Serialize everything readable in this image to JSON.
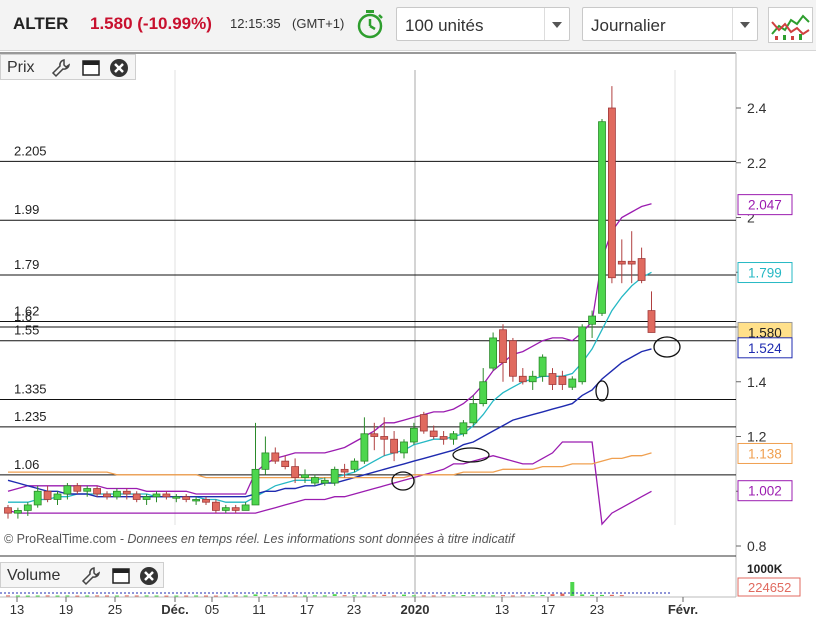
{
  "header": {
    "ticker": "ALTER",
    "price_change": "1.580 (-10.99%)",
    "time": "12:15:35",
    "timezone": "(GMT+1)",
    "quantity": "100 unités",
    "period": "Journalier"
  },
  "panes": {
    "price_label": "Prix",
    "volume_label": "Volume"
  },
  "copyright": "© ProRealTime.com",
  "disclaimer": " - Donnees en temps réel. Les informations sont données à titre indicatif",
  "colors": {
    "up": "#4dd64d",
    "down": "#e06a5f",
    "bollinger": "#9b1cb0",
    "ma_short": "#25b8c4",
    "ma_long": "#1f2bb0",
    "ma_slow": "#f0a050",
    "price_label": "#c8102e"
  },
  "chart_data": {
    "type": "candlestick",
    "y_axis_ticks": [
      "2.4",
      "2.2",
      "2",
      "1.8",
      "1.6",
      "1.4",
      "1.2",
      "1",
      "0.8"
    ],
    "x_axis_ticks": [
      "13",
      "19",
      "25",
      "Déc.",
      "05",
      "11",
      "17",
      "23",
      "2020",
      "13",
      "17",
      "23",
      "Févr."
    ],
    "ylim": [
      0.8,
      2.5
    ],
    "support_levels": [
      {
        "label": "2.205",
        "value": 2.205
      },
      {
        "label": "1.99",
        "value": 1.99
      },
      {
        "label": "1.79",
        "value": 1.79
      },
      {
        "label": "1.62",
        "value": 1.62
      },
      {
        "label": "1.6",
        "value": 1.6
      },
      {
        "label": "1.55",
        "value": 1.55
      },
      {
        "label": "1.335",
        "value": 1.335
      },
      {
        "label": "1.235",
        "value": 1.235
      },
      {
        "label": "1.06",
        "value": 1.06
      }
    ],
    "last_values": [
      {
        "label": "2.047",
        "value": 2.047,
        "color": "#9b1cb0"
      },
      {
        "label": "1.799",
        "value": 1.799,
        "color": "#25b8c4"
      },
      {
        "label": "1.580",
        "value": 1.58,
        "color": "#222222"
      },
      {
        "label": "1.524",
        "value": 1.524,
        "color": "#1f2bb0"
      },
      {
        "label": "1.138",
        "value": 1.138,
        "color": "#f0a050"
      },
      {
        "label": "1.002",
        "value": 1.002,
        "color": "#9b1cb0"
      }
    ],
    "volume": {
      "axis_label": "1000K",
      "last_value": "224652",
      "values": [
        15,
        12,
        10,
        12,
        14,
        11,
        13,
        10,
        12,
        14,
        13,
        12,
        15,
        13,
        14,
        12,
        10,
        11,
        12,
        13,
        12,
        11,
        12,
        14,
        13,
        40,
        20,
        18,
        15,
        14,
        13,
        16,
        15,
        45,
        20,
        18,
        14,
        16,
        30,
        15,
        35,
        17,
        15,
        14,
        20,
        18,
        25,
        20,
        18,
        16,
        22,
        14,
        18,
        20,
        24,
        45,
        60,
        350,
        40,
        30,
        28,
        30,
        22
      ]
    },
    "candles": [
      {
        "o": 0.94,
        "h": 0.95,
        "l": 0.9,
        "c": 0.92
      },
      {
        "o": 0.92,
        "h": 0.94,
        "l": 0.9,
        "c": 0.93
      },
      {
        "o": 0.93,
        "h": 0.96,
        "l": 0.91,
        "c": 0.95
      },
      {
        "o": 0.95,
        "h": 1.02,
        "l": 0.94,
        "c": 1.0
      },
      {
        "o": 1.0,
        "h": 1.02,
        "l": 0.96,
        "c": 0.97
      },
      {
        "o": 0.97,
        "h": 1.0,
        "l": 0.95,
        "c": 0.99
      },
      {
        "o": 0.99,
        "h": 1.03,
        "l": 0.97,
        "c": 1.02
      },
      {
        "o": 1.02,
        "h": 1.03,
        "l": 0.99,
        "c": 1.0
      },
      {
        "o": 1.0,
        "h": 1.02,
        "l": 0.98,
        "c": 1.01
      },
      {
        "o": 1.01,
        "h": 1.02,
        "l": 0.98,
        "c": 0.99
      },
      {
        "o": 0.99,
        "h": 1.0,
        "l": 0.97,
        "c": 0.98
      },
      {
        "o": 0.98,
        "h": 1.01,
        "l": 0.97,
        "c": 1.0
      },
      {
        "o": 1.0,
        "h": 1.01,
        "l": 0.97,
        "c": 0.99
      },
      {
        "o": 0.99,
        "h": 1.0,
        "l": 0.96,
        "c": 0.97
      },
      {
        "o": 0.97,
        "h": 0.99,
        "l": 0.95,
        "c": 0.98
      },
      {
        "o": 0.98,
        "h": 1.0,
        "l": 0.96,
        "c": 0.99
      },
      {
        "o": 0.99,
        "h": 1.0,
        "l": 0.97,
        "c": 0.98
      },
      {
        "o": 0.98,
        "h": 0.99,
        "l": 0.96,
        "c": 0.98
      },
      {
        "o": 0.98,
        "h": 0.99,
        "l": 0.96,
        "c": 0.97
      },
      {
        "o": 0.97,
        "h": 0.98,
        "l": 0.95,
        "c": 0.97
      },
      {
        "o": 0.97,
        "h": 0.98,
        "l": 0.95,
        "c": 0.96
      },
      {
        "o": 0.96,
        "h": 0.97,
        "l": 0.92,
        "c": 0.93
      },
      {
        "o": 0.93,
        "h": 0.95,
        "l": 0.92,
        "c": 0.94
      },
      {
        "o": 0.94,
        "h": 0.95,
        "l": 0.92,
        "c": 0.93
      },
      {
        "o": 0.93,
        "h": 0.96,
        "l": 0.93,
        "c": 0.95
      },
      {
        "o": 0.95,
        "h": 1.25,
        "l": 0.95,
        "c": 1.08
      },
      {
        "o": 1.08,
        "h": 1.2,
        "l": 1.06,
        "c": 1.14
      },
      {
        "o": 1.14,
        "h": 1.16,
        "l": 1.1,
        "c": 1.11
      },
      {
        "o": 1.11,
        "h": 1.13,
        "l": 1.08,
        "c": 1.09
      },
      {
        "o": 1.09,
        "h": 1.12,
        "l": 1.03,
        "c": 1.05
      },
      {
        "o": 1.05,
        "h": 1.08,
        "l": 1.03,
        "c": 1.06
      },
      {
        "o": 1.03,
        "h": 1.06,
        "l": 1.02,
        "c": 1.05
      },
      {
        "o": 1.03,
        "h": 1.05,
        "l": 1.02,
        "c": 1.04
      },
      {
        "o": 1.03,
        "h": 1.09,
        "l": 1.02,
        "c": 1.08
      },
      {
        "o": 1.08,
        "h": 1.1,
        "l": 1.05,
        "c": 1.07
      },
      {
        "o": 1.08,
        "h": 1.12,
        "l": 1.07,
        "c": 1.11
      },
      {
        "o": 1.11,
        "h": 1.27,
        "l": 1.1,
        "c": 1.21
      },
      {
        "o": 1.21,
        "h": 1.25,
        "l": 1.15,
        "c": 1.2
      },
      {
        "o": 1.2,
        "h": 1.27,
        "l": 1.13,
        "c": 1.19
      },
      {
        "o": 1.19,
        "h": 1.22,
        "l": 1.11,
        "c": 1.14
      },
      {
        "o": 1.14,
        "h": 1.19,
        "l": 1.12,
        "c": 1.18
      },
      {
        "o": 1.18,
        "h": 1.25,
        "l": 1.17,
        "c": 1.23
      },
      {
        "o": 1.28,
        "h": 1.29,
        "l": 1.21,
        "c": 1.22
      },
      {
        "o": 1.22,
        "h": 1.24,
        "l": 1.19,
        "c": 1.2
      },
      {
        "o": 1.2,
        "h": 1.22,
        "l": 1.17,
        "c": 1.19
      },
      {
        "o": 1.19,
        "h": 1.22,
        "l": 1.17,
        "c": 1.21
      },
      {
        "o": 1.21,
        "h": 1.26,
        "l": 1.2,
        "c": 1.25
      },
      {
        "o": 1.25,
        "h": 1.35,
        "l": 1.24,
        "c": 1.32
      },
      {
        "o": 1.32,
        "h": 1.45,
        "l": 1.31,
        "c": 1.4
      },
      {
        "o": 1.45,
        "h": 1.58,
        "l": 1.44,
        "c": 1.56
      },
      {
        "o": 1.59,
        "h": 1.61,
        "l": 1.4,
        "c": 1.47
      },
      {
        "o": 1.55,
        "h": 1.56,
        "l": 1.4,
        "c": 1.42
      },
      {
        "o": 1.42,
        "h": 1.45,
        "l": 1.39,
        "c": 1.4
      },
      {
        "o": 1.4,
        "h": 1.44,
        "l": 1.37,
        "c": 1.42
      },
      {
        "o": 1.42,
        "h": 1.5,
        "l": 1.4,
        "c": 1.49
      },
      {
        "o": 1.43,
        "h": 1.45,
        "l": 1.37,
        "c": 1.39
      },
      {
        "o": 1.42,
        "h": 1.44,
        "l": 1.37,
        "c": 1.39
      },
      {
        "o": 1.38,
        "h": 1.42,
        "l": 1.37,
        "c": 1.41
      },
      {
        "o": 1.4,
        "h": 1.61,
        "l": 1.39,
        "c": 1.6
      },
      {
        "o": 1.61,
        "h": 1.66,
        "l": 1.56,
        "c": 1.64
      },
      {
        "o": 1.65,
        "h": 2.36,
        "l": 1.64,
        "c": 2.35
      },
      {
        "o": 2.4,
        "h": 2.48,
        "l": 1.76,
        "c": 1.78
      },
      {
        "o": 1.84,
        "h": 1.92,
        "l": 1.76,
        "c": 1.83
      },
      {
        "o": 1.84,
        "h": 1.95,
        "l": 1.76,
        "c": 1.83
      },
      {
        "o": 1.85,
        "h": 1.89,
        "l": 1.76,
        "c": 1.77
      },
      {
        "o": 1.66,
        "h": 1.73,
        "l": 1.58,
        "c": 1.58
      }
    ],
    "series": [
      {
        "values": [
          1.0,
          1.01,
          1.02,
          1.02,
          1.02,
          1.02,
          1.02,
          1.02,
          1.02,
          1.02,
          1.01,
          1.01,
          1.01,
          1.01,
          1.0,
          1.0,
          1.0,
          1.0,
          1.0,
          0.99,
          0.99,
          0.99,
          0.99,
          0.99,
          0.99,
          1.07,
          1.1,
          1.12,
          1.13,
          1.14,
          1.14,
          1.14,
          1.14,
          1.15,
          1.16,
          1.18,
          1.2,
          1.22,
          1.25,
          1.25,
          1.26,
          1.27,
          1.28,
          1.29,
          1.29,
          1.3,
          1.32,
          1.35,
          1.39,
          1.44,
          1.47,
          1.5,
          1.51,
          1.53,
          1.55,
          1.56,
          1.56,
          1.55,
          1.58,
          1.62,
          1.85,
          1.95,
          2.0,
          2.02,
          2.04,
          2.05
        ]
      },
      {
        "values": [
          0.93,
          0.92,
          0.92,
          0.92,
          0.92,
          0.92,
          0.92,
          0.92,
          0.92,
          0.92,
          0.92,
          0.92,
          0.92,
          0.92,
          0.92,
          0.92,
          0.92,
          0.92,
          0.92,
          0.92,
          0.92,
          0.92,
          0.92,
          0.92,
          0.92,
          0.92,
          0.93,
          0.94,
          0.95,
          0.96,
          0.97,
          0.97,
          0.97,
          0.98,
          0.98,
          0.99,
          1.0,
          1.01,
          1.02,
          1.03,
          1.04,
          1.05,
          1.06,
          1.07,
          1.08,
          1.1,
          1.1,
          1.11,
          1.12,
          1.13,
          1.12,
          1.11,
          1.1,
          1.1,
          1.12,
          1.14,
          1.18,
          1.18,
          1.18,
          1.18,
          0.88,
          0.92,
          0.94,
          0.96,
          0.98,
          1.0
        ]
      },
      {
        "values": [
          0.96,
          0.96,
          0.96,
          0.97,
          0.97,
          0.98,
          0.98,
          0.99,
          0.99,
          0.99,
          0.99,
          0.99,
          0.99,
          0.99,
          0.99,
          0.98,
          0.98,
          0.98,
          0.98,
          0.98,
          0.97,
          0.97,
          0.96,
          0.96,
          0.96,
          0.98,
          1.0,
          1.02,
          1.03,
          1.04,
          1.04,
          1.04,
          1.05,
          1.05,
          1.06,
          1.07,
          1.09,
          1.11,
          1.13,
          1.14,
          1.15,
          1.17,
          1.18,
          1.19,
          1.19,
          1.2,
          1.21,
          1.24,
          1.28,
          1.33,
          1.36,
          1.38,
          1.4,
          1.41,
          1.42,
          1.42,
          1.42,
          1.43,
          1.47,
          1.52,
          1.59,
          1.66,
          1.71,
          1.75,
          1.78,
          1.8
        ]
      },
      {
        "values": [
          1.04,
          1.03,
          1.02,
          1.01,
          1.0,
          1.0,
          0.99,
          0.99,
          0.99,
          0.98,
          0.98,
          0.98,
          0.98,
          0.98,
          0.98,
          0.98,
          0.98,
          0.98,
          0.98,
          0.98,
          0.98,
          0.98,
          0.98,
          0.98,
          0.98,
          0.99,
          1.0,
          1.0,
          1.01,
          1.01,
          1.02,
          1.02,
          1.03,
          1.03,
          1.04,
          1.05,
          1.06,
          1.07,
          1.08,
          1.09,
          1.1,
          1.11,
          1.12,
          1.13,
          1.14,
          1.15,
          1.17,
          1.18,
          1.2,
          1.22,
          1.24,
          1.26,
          1.27,
          1.28,
          1.29,
          1.3,
          1.31,
          1.32,
          1.35,
          1.37,
          1.41,
          1.44,
          1.47,
          1.49,
          1.51,
          1.52
        ]
      },
      {
        "values": [
          1.07,
          1.07,
          1.07,
          1.07,
          1.07,
          1.07,
          1.07,
          1.07,
          1.07,
          1.07,
          1.07,
          1.06,
          1.06,
          1.06,
          1.06,
          1.06,
          1.06,
          1.06,
          1.06,
          1.06,
          1.05,
          1.05,
          1.05,
          1.05,
          1.05,
          1.05,
          1.05,
          1.05,
          1.05,
          1.05,
          1.05,
          1.05,
          1.05,
          1.05,
          1.05,
          1.05,
          1.05,
          1.05,
          1.05,
          1.05,
          1.05,
          1.06,
          1.06,
          1.06,
          1.06,
          1.06,
          1.07,
          1.07,
          1.07,
          1.07,
          1.08,
          1.08,
          1.08,
          1.08,
          1.09,
          1.09,
          1.09,
          1.1,
          1.1,
          1.1,
          1.11,
          1.12,
          1.12,
          1.13,
          1.13,
          1.14
        ]
      }
    ]
  }
}
